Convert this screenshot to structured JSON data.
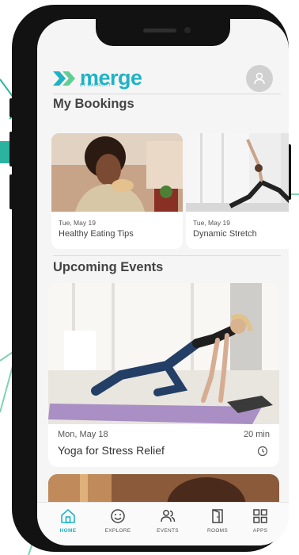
{
  "app": {
    "brand": "merge",
    "brand_sub": "BY MARRIOTT"
  },
  "header": {
    "avatar_icon": "user-icon"
  },
  "bookings": {
    "title": "My Bookings",
    "items": [
      {
        "date": "Tue, May 19",
        "name": "Healthy Eating Tips"
      },
      {
        "date": "Tue, May 19",
        "name": "Dynamic Stretch"
      }
    ]
  },
  "events": {
    "title": "Upcoming Events",
    "items": [
      {
        "date": "Mon, May 18",
        "duration": "20 min",
        "name": "Yoga for Stress Relief"
      }
    ]
  },
  "tabbar": {
    "tabs": [
      {
        "label": "HOME",
        "icon": "home-icon",
        "active": true
      },
      {
        "label": "EXPLORE",
        "icon": "smiley-icon"
      },
      {
        "label": "EVENTS",
        "icon": "people-icon"
      },
      {
        "label": "ROOMS",
        "icon": "door-icon"
      },
      {
        "label": "APPS",
        "icon": "grid-icon"
      }
    ]
  },
  "colors": {
    "accent": "#1fb3c4",
    "accent_green": "#5fcf94",
    "screen_bg": "#f5f5f5"
  }
}
